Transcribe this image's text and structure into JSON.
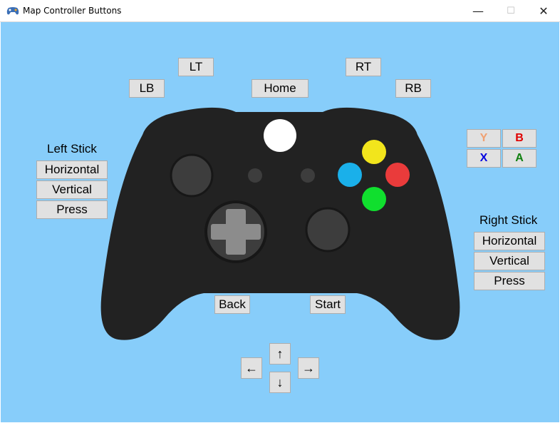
{
  "window": {
    "title": "Map Controller Buttons",
    "minimize": "—",
    "maximize": "☐",
    "close": "✕"
  },
  "colors": {
    "background": "#87cdfa",
    "controller_body": "#222222",
    "button_y": "#f2e51c",
    "button_b": "#ea3b3b",
    "button_x": "#1ab0ea",
    "button_a": "#10df2e",
    "label_y": "#f0a070",
    "label_b": "#e00000",
    "label_x": "#0000e0",
    "label_a": "#108010"
  },
  "buttons": {
    "lt": "LT",
    "rt": "RT",
    "lb": "LB",
    "rb": "RB",
    "home": "Home",
    "back": "Back",
    "start": "Start"
  },
  "left_stick": {
    "title": "Left Stick",
    "horizontal": "Horizontal",
    "vertical": "Vertical",
    "press": "Press"
  },
  "right_stick": {
    "title": "Right Stick",
    "horizontal": "Horizontal",
    "vertical": "Vertical",
    "press": "Press"
  },
  "face_buttons": {
    "y": "Y",
    "b": "B",
    "x": "X",
    "a": "A"
  },
  "dpad": {
    "up": "↑",
    "down": "↓",
    "left": "←",
    "right": "→"
  }
}
